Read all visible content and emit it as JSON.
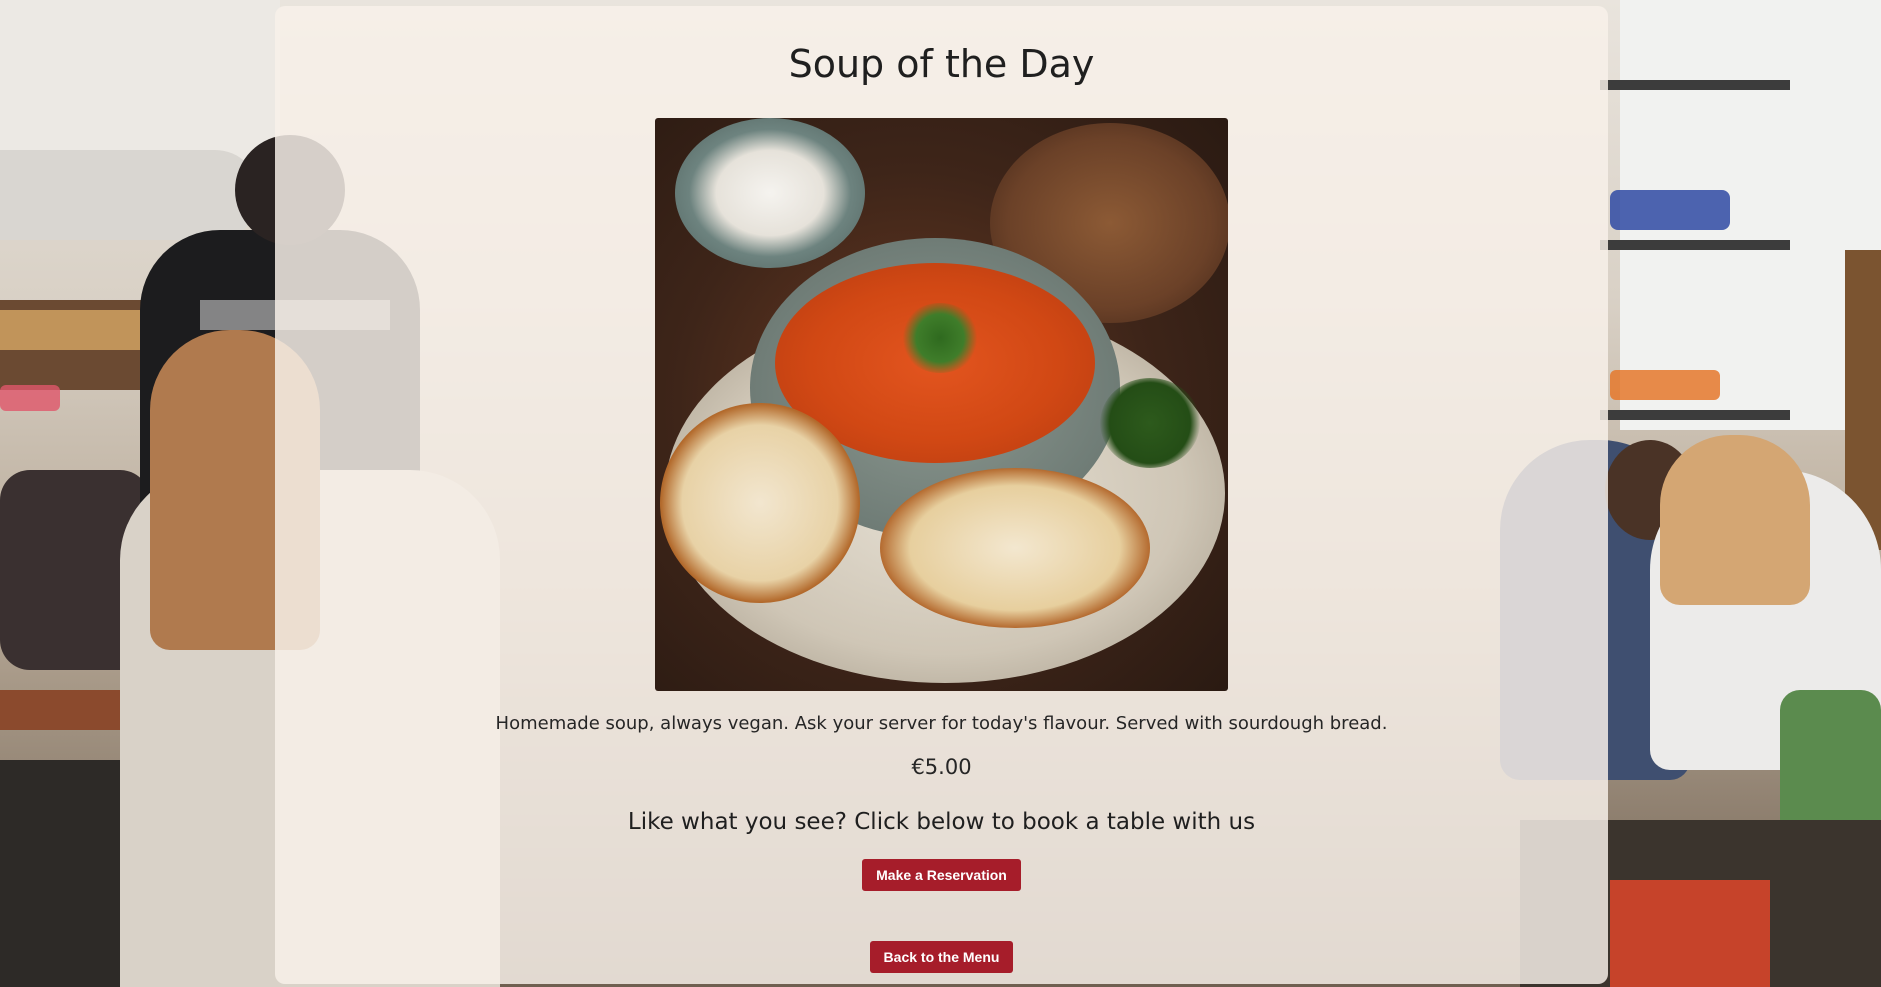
{
  "page": {
    "title": "Soup of the Day",
    "description": "Homemade soup, always vegan. Ask your server for today's flavour. Served with sourdough bread.",
    "price": "€5.00",
    "cta_text": "Like what you see? Click below to book a table with us"
  },
  "buttons": {
    "reservation_label": "Make a Reservation",
    "back_label": "Back to the Menu"
  },
  "images": {
    "dish_alt": "Bowl of tomato soup with sourdough bread",
    "background": "cafe-interior-photo"
  },
  "colors": {
    "button_bg": "#a61d2a",
    "button_text": "#ffffff",
    "card_bg": "#f8f1ea"
  }
}
